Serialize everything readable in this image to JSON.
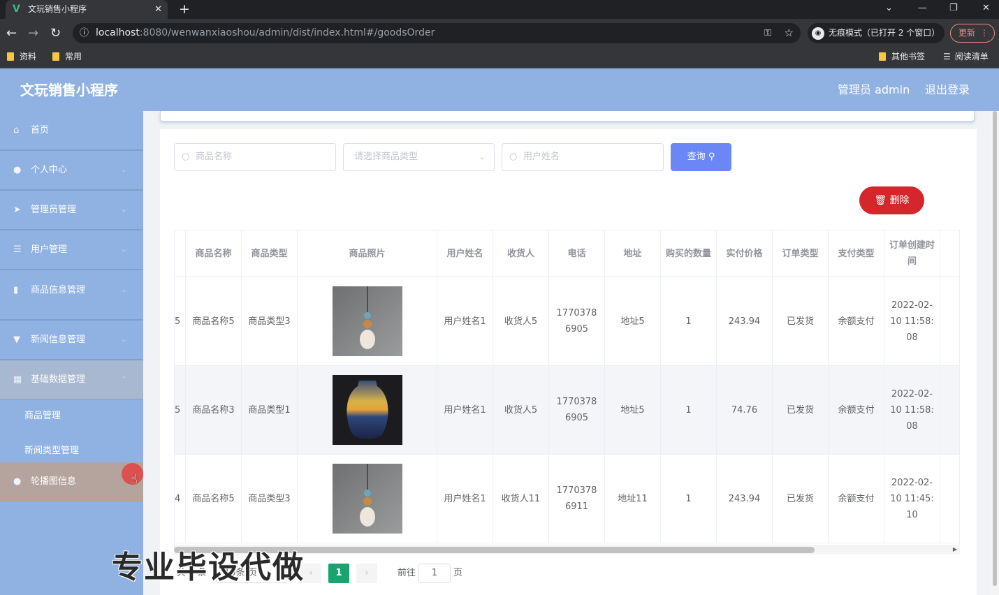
{
  "browser": {
    "tab_title": "文玩销售小程序",
    "tab_icon": "V",
    "url_host": "localhost",
    "url_rest": ":8080/wenwanxiaoshou/admin/dist/index.html#/goodsOrder",
    "incognito_label": "无痕模式（已打开 2 个窗口）",
    "update_label": "更新",
    "bookmarks": [
      "资料",
      "常用"
    ],
    "bookmarks_right": [
      "其他书签",
      "阅读清单"
    ]
  },
  "header": {
    "title": "文玩销售小程序",
    "admin_label": "管理员 admin",
    "logout_label": "退出登录"
  },
  "sidebar": {
    "items": [
      {
        "label": "首页",
        "icon": "home-icon"
      },
      {
        "label": "个人中心",
        "icon": "user-icon"
      },
      {
        "label": "管理员管理",
        "icon": "send-icon"
      },
      {
        "label": "用户管理",
        "icon": "list-icon"
      },
      {
        "label": "商品信息管理",
        "icon": "bar-chart-icon"
      },
      {
        "label": "新闻信息管理",
        "icon": "thumb-icon"
      },
      {
        "label": "基础数据管理",
        "icon": "grid-icon"
      }
    ],
    "sub_items": [
      "商品管理",
      "新闻类型管理"
    ],
    "carousel_item": "轮播图信息"
  },
  "search": {
    "goods_name_placeholder": "商品名称",
    "goods_type_placeholder": "请选择商品类型",
    "user_name_placeholder": "用户姓名",
    "query_label": "查询",
    "delete_label": "删除"
  },
  "table": {
    "headers": [
      "商品名称",
      "商品类型",
      "商品照片",
      "用户姓名",
      "收货人",
      "电话",
      "地址",
      "购买的数量",
      "实付价格",
      "订单类型",
      "支付类型",
      "订单创建时间"
    ],
    "rows": [
      {
        "id_fragment": "5",
        "goods_name": "商品名称5",
        "goods_type": "商品类型3",
        "photo": "pendant",
        "user_name": "用户姓名1",
        "receiver": "收货人5",
        "phone": "17703786905",
        "address": "地址5",
        "quantity": "1",
        "price": "243.94",
        "order_type": "已发货",
        "pay_type": "余额支付",
        "created": "2022-02-10 11:58:08"
      },
      {
        "id_fragment": "5",
        "goods_name": "商品名称3",
        "goods_type": "商品类型1",
        "photo": "vase",
        "user_name": "用户姓名1",
        "receiver": "收货人5",
        "phone": "17703786905",
        "address": "地址5",
        "quantity": "1",
        "price": "74.76",
        "order_type": "已发货",
        "pay_type": "余额支付",
        "created": "2022-02-10 11:58:08"
      },
      {
        "id_fragment": "4",
        "goods_name": "商品名称5",
        "goods_type": "商品类型3",
        "photo": "pendant",
        "user_name": "用户姓名1",
        "receiver": "收货人11",
        "phone": "17703786911",
        "address": "地址11",
        "quantity": "1",
        "price": "243.94",
        "order_type": "已发货",
        "pay_type": "余额支付",
        "created": "2022-02-10 11:45:10"
      }
    ]
  },
  "pagination": {
    "total_prefix": "共 3 条",
    "page_size": "10条/页",
    "current_page": "1",
    "goto_label": "前往",
    "goto_value": "1",
    "page_suffix": "页"
  },
  "watermark": "专业毕设代做",
  "colors": {
    "header_bg": "#8fb2e2",
    "query_btn": "#6a87f5",
    "delete_btn": "#d5262b",
    "active_page": "#19a36f"
  }
}
